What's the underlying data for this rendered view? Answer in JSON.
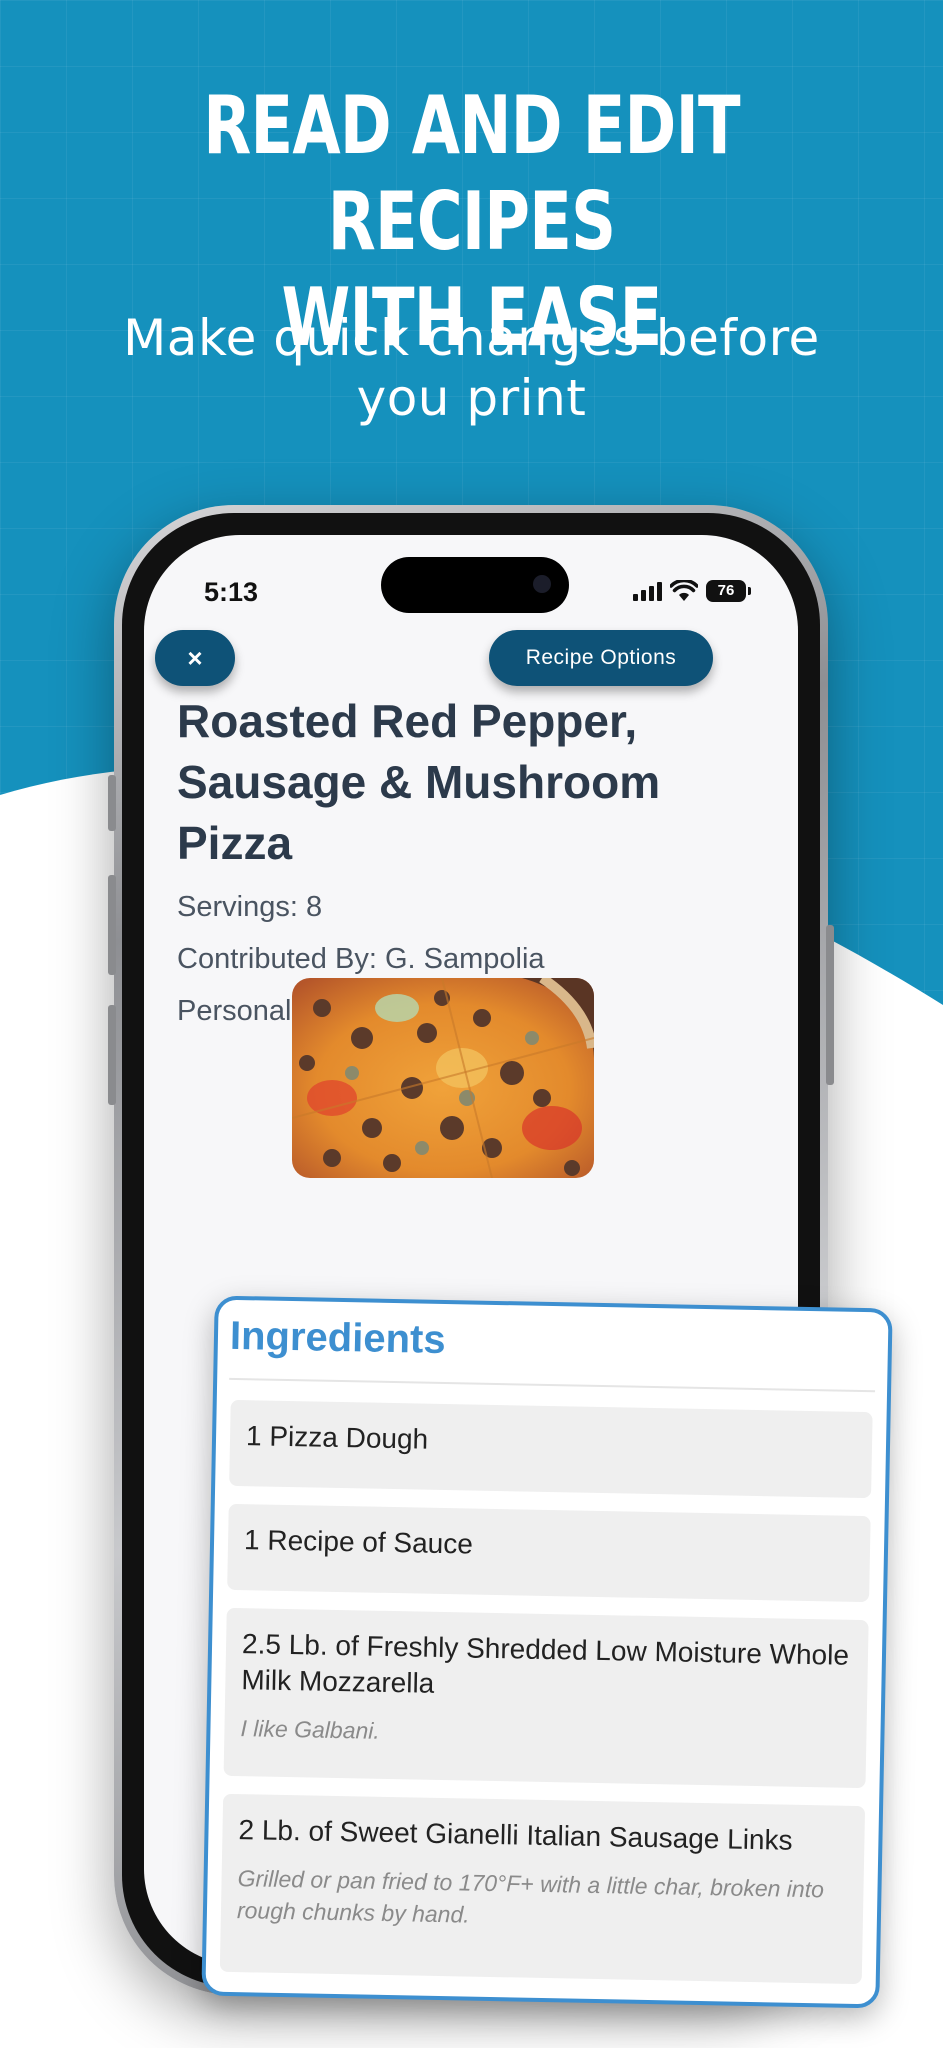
{
  "hero": {
    "headline_line1": "READ AND EDIT RECIPES",
    "headline_line2": "WITH EASE",
    "subhead_line1": "Make quick changes before",
    "subhead_line2": "you print"
  },
  "status_bar": {
    "time": "5:13",
    "battery": "76"
  },
  "toolbar": {
    "close_label": "×",
    "options_label": "Recipe  Options"
  },
  "recipe": {
    "title_line1": "Roasted Red Pepper,",
    "title_line2": "Sausage & Mushroom",
    "title_line3": "Pizza",
    "servings": "Servings: 8",
    "contributed_by": "Contributed By: G. Sampolia",
    "personal_note": "Personal Note:"
  },
  "ingredients": {
    "title": "Ingredients",
    "items": [
      {
        "name": "1 Pizza Dough",
        "note": ""
      },
      {
        "name": "1 Recipe of Sauce",
        "note": ""
      },
      {
        "name": "2.5 Lb. of Freshly Shredded Low Moisture Whole Milk Mozzarella",
        "note": "I like Galbani."
      },
      {
        "name": "2 Lb. of Sweet Gianelli Italian Sausage Links",
        "note": "Grilled or pan fried to 170°F+ with a little char, broken into rough chunks by hand."
      }
    ]
  },
  "colors": {
    "background": "#1591bd",
    "button": "#0e5277",
    "card_accent": "#3d8fd0",
    "title_text": "#2c3a4b"
  },
  "icons": [
    "close-icon",
    "cellular-icon",
    "wifi-icon",
    "battery-icon"
  ]
}
